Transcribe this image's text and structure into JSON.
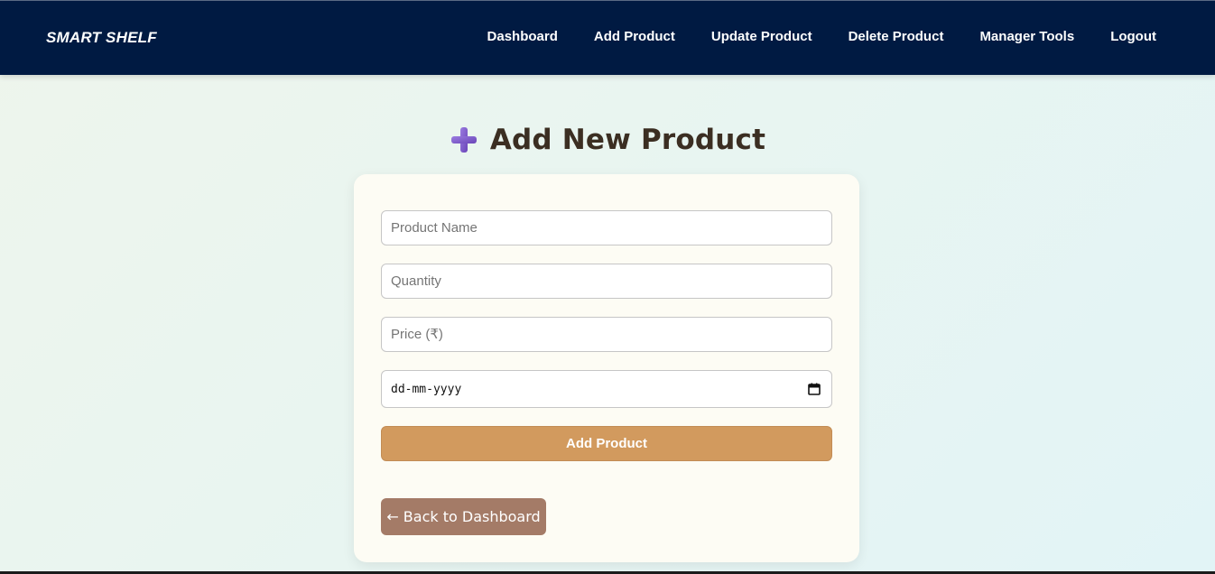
{
  "navbar": {
    "brand": "SMART SHELF",
    "links": [
      {
        "label": "Dashboard"
      },
      {
        "label": "Add Product"
      },
      {
        "label": "Update Product"
      },
      {
        "label": "Delete Product"
      },
      {
        "label": "Manager Tools"
      },
      {
        "label": "Logout"
      }
    ]
  },
  "page": {
    "title": "Add New Product",
    "title_icon": "plus-icon"
  },
  "form": {
    "product_name_placeholder": "Product Name",
    "product_name_value": "",
    "quantity_placeholder": "Quantity",
    "quantity_value": "",
    "price_placeholder": "Price (₹)",
    "price_value": "",
    "date_display": "dd-mm-yyyy",
    "date_icon": "calendar-icon",
    "submit_label": "Add Product"
  },
  "back_button": {
    "label": "← Back to Dashboard"
  },
  "colors": {
    "navbar_bg": "#001a42",
    "submit_bg": "#d29a5e",
    "back_bg": "#a47b67",
    "title_color": "#3b2e22",
    "plus_icon": "#7b57c6"
  }
}
